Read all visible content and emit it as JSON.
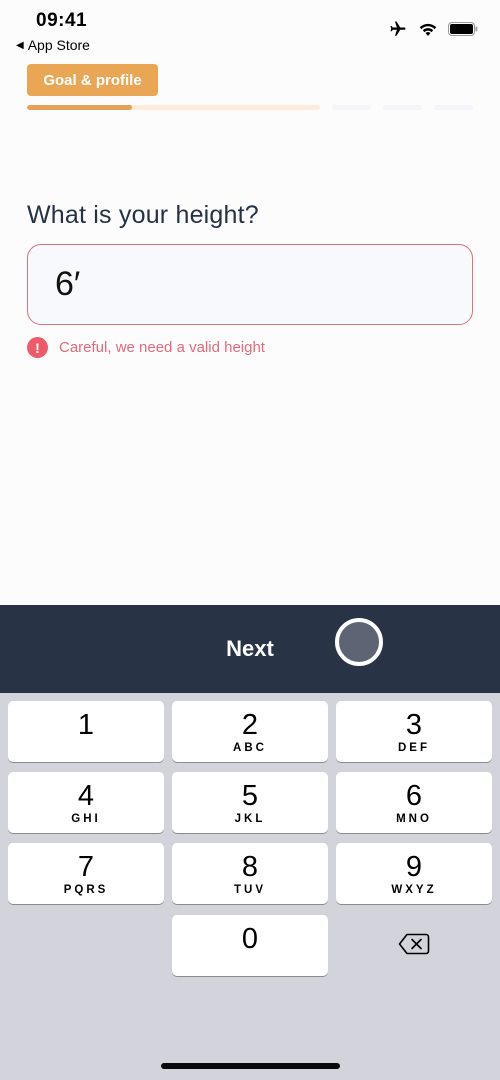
{
  "status_bar": {
    "time": "09:41",
    "back_label": "App Store",
    "icons": [
      "airplane-icon",
      "wifi-icon",
      "battery-icon"
    ]
  },
  "header": {
    "section_badge": "Goal & profile",
    "progress": {
      "segments": 4,
      "current_segment": 1,
      "current_segment_fill_fraction": 0.36
    }
  },
  "form": {
    "question": "What is your height?",
    "input_value": "6′",
    "error_message": "Careful, we need a valid height",
    "error_icon": "exclamation-circle-icon"
  },
  "accessory_bar": {
    "next_label": "Next"
  },
  "keyboard": {
    "keys": [
      {
        "digit": "1",
        "letters": ""
      },
      {
        "digit": "2",
        "letters": "ABC"
      },
      {
        "digit": "3",
        "letters": "DEF"
      },
      {
        "digit": "4",
        "letters": "GHI"
      },
      {
        "digit": "5",
        "letters": "JKL"
      },
      {
        "digit": "6",
        "letters": "MNO"
      },
      {
        "digit": "7",
        "letters": "PQRS"
      },
      {
        "digit": "8",
        "letters": "TUV"
      },
      {
        "digit": "9",
        "letters": "WXYZ"
      },
      {
        "digit": "0",
        "letters": ""
      }
    ],
    "backspace_icon": "backspace-icon"
  },
  "colors": {
    "accent": "#e9a654",
    "error": "#ec5b67",
    "accessory_bg": "#283446",
    "keyboard_bg": "#d3d4db"
  }
}
